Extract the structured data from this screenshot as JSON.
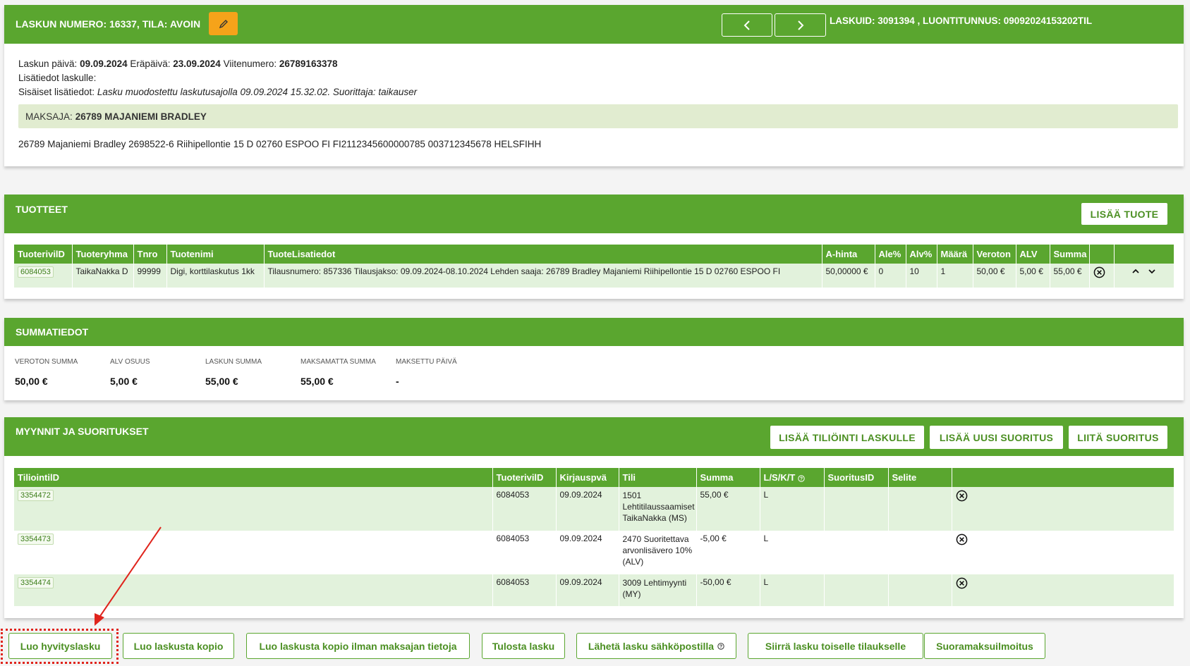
{
  "invoice": {
    "header_title": "LASKUN NUMERO: 16337, TILA: AVOIN",
    "meta_right": "LASKUID: 3091394 , LUONTITUNNUS: 09092024153202TIL",
    "date_label": "Laskun päivä:",
    "date": "09.09.2024",
    "due_label": "Eräpäivä:",
    "due": "23.09.2024",
    "ref_label": "Viitenumero:",
    "ref": "26789163378",
    "extra_label": "Lisätiedot laskulle:",
    "internal_label": "Sisäiset lisätiedot:",
    "internal_value": "Lasku muodostettu laskutusajolla 09.09.2024 15.32.02. Suorittaja: taikauser",
    "payer_label": "MAKSAJA:",
    "payer_name": "26789 MAJANIEMI BRADLEY",
    "payer_details": "26789 Majaniemi Bradley 2698522-6 Riihipellontie 15 D 02760 ESPOO FI FI2112345600000785 003712345678 HELSFIHH"
  },
  "products": {
    "title": "TUOTTEET",
    "add_button": "LISÄÄ TUOTE",
    "columns": [
      "TuoterivilD",
      "Tuoteryhma",
      "Tnro",
      "Tuotenimi",
      "TuoteLisatiedot",
      "A-hinta",
      "Ale%",
      "Alv%",
      "Määrä",
      "Veroton",
      "ALV",
      "Summa"
    ],
    "rows": [
      {
        "id": "6084053",
        "group": "TaikaNakka D",
        "tnro": "99999",
        "name": "Digi, korttilaskutus 1kk",
        "info": "Tilausnumero: 857336 Tilausjakso: 09.09.2024-08.10.2024 Lehden saaja: 26789 Bradley Majaniemi Riihipellontie 15 D 02760 ESPOO FI",
        "price": "50,00000 €",
        "discount": "0",
        "vat_pct": "10",
        "qty": "1",
        "net": "50,00 €",
        "vat": "5,00 €",
        "sum": "55,00 €"
      }
    ]
  },
  "summary": {
    "title": "SUMMATIEDOT",
    "items": [
      {
        "label": "VEROTON SUMMA",
        "value": "50,00 €"
      },
      {
        "label": "ALV OSUUS",
        "value": "5,00 €"
      },
      {
        "label": "LASKUN SUMMA",
        "value": "55,00 €"
      },
      {
        "label": "MAKSAMATTA SUMMA",
        "value": "55,00 €"
      },
      {
        "label": "MAKSETTU PÄIVÄ",
        "value": "-"
      }
    ]
  },
  "sales": {
    "title": "MYYNNIT JA SUORITUKSET",
    "buttons": [
      "LISÄÄ TILIÖINTI LASKULLE",
      "LISÄÄ UUSI SUORITUS",
      "LIITÄ SUORITUS"
    ],
    "columns": [
      "TiliointilD",
      "TuoterivilD",
      "Kirjauspvä",
      "Tili",
      "Summa",
      "L/S/K/T",
      "SuoritusID",
      "Selite"
    ],
    "rows": [
      {
        "id": "3354472",
        "row_id": "6084053",
        "date": "09.09.2024",
        "account": "1501 Lehtitilaussaamiset TaikaNakka (MS)",
        "sum": "55,00 €",
        "lskt": "L",
        "payment_id": "",
        "note": ""
      },
      {
        "id": "3354473",
        "row_id": "6084053",
        "date": "09.09.2024",
        "account": "2470 Suoritettava arvonlisävero 10% (ALV)",
        "sum": "-5,00 €",
        "lskt": "L",
        "payment_id": "",
        "note": ""
      },
      {
        "id": "3354474",
        "row_id": "6084053",
        "date": "09.09.2024",
        "account": "3009 Lehtimyynti (MY)",
        "sum": "-50,00 €",
        "lskt": "L",
        "payment_id": "",
        "note": ""
      }
    ]
  },
  "actions": {
    "credit": "Luo hyvityslasku",
    "copy": "Luo laskusta kopio",
    "copy_no_payer": "Luo laskusta kopio ilman maksajan tietoja",
    "print": "Tulosta lasku",
    "email": "Lähetä lasku sähköpostilla",
    "move": "Siirrä lasku toiselle tilaukselle",
    "direct": "Suoramaksuilmoitus"
  },
  "colors": {
    "accent": "#5aa62f",
    "highlight": "#e0241c",
    "edit": "#f5a31a"
  },
  "icons": [
    "pencil-icon",
    "chevron-left-icon",
    "chevron-right-icon",
    "delete-circle-icon",
    "chevron-up-icon",
    "chevron-down-icon",
    "help-icon",
    "arrow-annotation"
  ]
}
